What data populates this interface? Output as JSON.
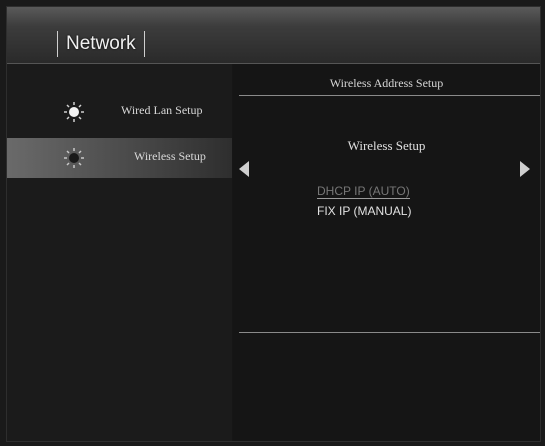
{
  "header": {
    "title": "Network"
  },
  "sidebar": {
    "items": [
      {
        "label": "Wired Lan Setup",
        "icon": "bulb-icon",
        "selected": false
      },
      {
        "label": "Wireless Setup",
        "icon": "bulb-icon",
        "selected": true
      }
    ]
  },
  "panel": {
    "title": "Wireless Address Setup",
    "setup_label": "Wireless Setup",
    "options": [
      {
        "label": "DHCP IP (AUTO)",
        "highlighted": true
      },
      {
        "label": "FIX IP (MANUAL)",
        "highlighted": false
      }
    ]
  },
  "colors": {
    "background": "#161616",
    "selected_item": "#5a5a5a",
    "text": "#e6e6e6",
    "dim_text": "#777777"
  }
}
